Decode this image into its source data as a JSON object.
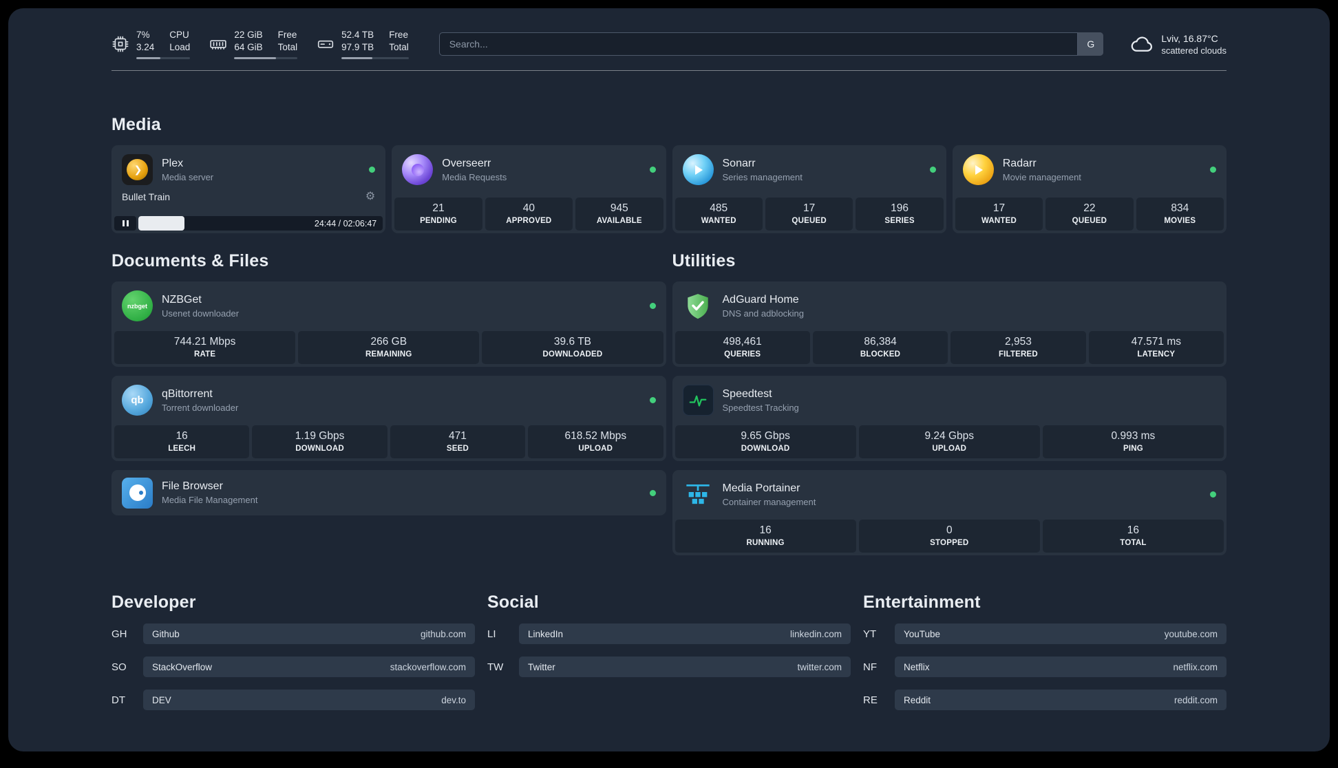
{
  "colors": {
    "status_green": "#43cf7c",
    "page_bg": "#1d2634",
    "card_bg": "#28323f"
  },
  "topbar": {
    "cpu": {
      "value1": "7%",
      "value2": "3.24",
      "label1": "CPU",
      "label2": "Load",
      "bar_percent": 45
    },
    "memory": {
      "value1": "22 GiB",
      "value2": "64 GiB",
      "label1": "Free",
      "label2": "Total",
      "bar_percent": 66
    },
    "disk": {
      "value1": "52.4 TB",
      "value2": "97.9 TB",
      "label1": "Free",
      "label2": "Total",
      "bar_percent": 46
    },
    "search": {
      "placeholder": "Search...",
      "button_label": "G"
    },
    "weather": {
      "location": "Lviv, 16.87°C",
      "condition": "scattered clouds"
    }
  },
  "sections": {
    "media": "Media",
    "documents": "Documents & Files",
    "utilities": "Utilities",
    "developer": "Developer",
    "social": "Social",
    "entertainment": "Entertainment"
  },
  "services": {
    "plex": {
      "name": "Plex",
      "desc": "Media server",
      "now_playing": "Bullet Train",
      "time": "24:44 / 02:06:47",
      "progress_percent": 19
    },
    "overseerr": {
      "name": "Overseerr",
      "desc": "Media Requests",
      "stats": [
        {
          "value": "21",
          "label": "PENDING"
        },
        {
          "value": "40",
          "label": "APPROVED"
        },
        {
          "value": "945",
          "label": "AVAILABLE"
        }
      ]
    },
    "sonarr": {
      "name": "Sonarr",
      "desc": "Series management",
      "stats": [
        {
          "value": "485",
          "label": "WANTED"
        },
        {
          "value": "17",
          "label": "QUEUED"
        },
        {
          "value": "196",
          "label": "SERIES"
        }
      ]
    },
    "radarr": {
      "name": "Radarr",
      "desc": "Movie management",
      "stats": [
        {
          "value": "17",
          "label": "WANTED"
        },
        {
          "value": "22",
          "label": "QUEUED"
        },
        {
          "value": "834",
          "label": "MOVIES"
        }
      ]
    },
    "nzbget": {
      "name": "NZBGet",
      "desc": "Usenet downloader",
      "icon_text": "nzbget",
      "stats": [
        {
          "value": "744.21 Mbps",
          "label": "RATE"
        },
        {
          "value": "266 GB",
          "label": "REMAINING"
        },
        {
          "value": "39.6 TB",
          "label": "DOWNLOADED"
        }
      ]
    },
    "qbittorrent": {
      "name": "qBittorrent",
      "desc": "Torrent downloader",
      "icon_text": "qb",
      "stats": [
        {
          "value": "16",
          "label": "LEECH"
        },
        {
          "value": "1.19 Gbps",
          "label": "DOWNLOAD"
        },
        {
          "value": "471",
          "label": "SEED"
        },
        {
          "value": "618.52 Mbps",
          "label": "UPLOAD"
        }
      ]
    },
    "filebrowser": {
      "name": "File Browser",
      "desc": "Media File Management"
    },
    "adguard": {
      "name": "AdGuard Home",
      "desc": "DNS and adblocking",
      "stats": [
        {
          "value": "498,461",
          "label": "QUERIES"
        },
        {
          "value": "86,384",
          "label": "BLOCKED"
        },
        {
          "value": "2,953",
          "label": "FILTERED"
        },
        {
          "value": "47.571 ms",
          "label": "LATENCY"
        }
      ]
    },
    "speedtest": {
      "name": "Speedtest",
      "desc": "Speedtest Tracking",
      "stats": [
        {
          "value": "9.65 Gbps",
          "label": "DOWNLOAD"
        },
        {
          "value": "9.24 Gbps",
          "label": "UPLOAD"
        },
        {
          "value": "0.993 ms",
          "label": "PING"
        }
      ]
    },
    "portainer": {
      "name": "Media Portainer",
      "desc": "Container management",
      "stats": [
        {
          "value": "16",
          "label": "RUNNING"
        },
        {
          "value": "0",
          "label": "STOPPED"
        },
        {
          "value": "16",
          "label": "TOTAL"
        }
      ]
    }
  },
  "bookmarks": {
    "developer": [
      {
        "abbr": "GH",
        "name": "Github",
        "domain": "github.com"
      },
      {
        "abbr": "SO",
        "name": "StackOverflow",
        "domain": "stackoverflow.com"
      },
      {
        "abbr": "DT",
        "name": "DEV",
        "domain": "dev.to"
      }
    ],
    "social": [
      {
        "abbr": "LI",
        "name": "LinkedIn",
        "domain": "linkedin.com"
      },
      {
        "abbr": "TW",
        "name": "Twitter",
        "domain": "twitter.com"
      }
    ],
    "entertainment": [
      {
        "abbr": "YT",
        "name": "YouTube",
        "domain": "youtube.com"
      },
      {
        "abbr": "NF",
        "name": "Netflix",
        "domain": "netflix.com"
      },
      {
        "abbr": "RE",
        "name": "Reddit",
        "domain": "reddit.com"
      }
    ]
  }
}
